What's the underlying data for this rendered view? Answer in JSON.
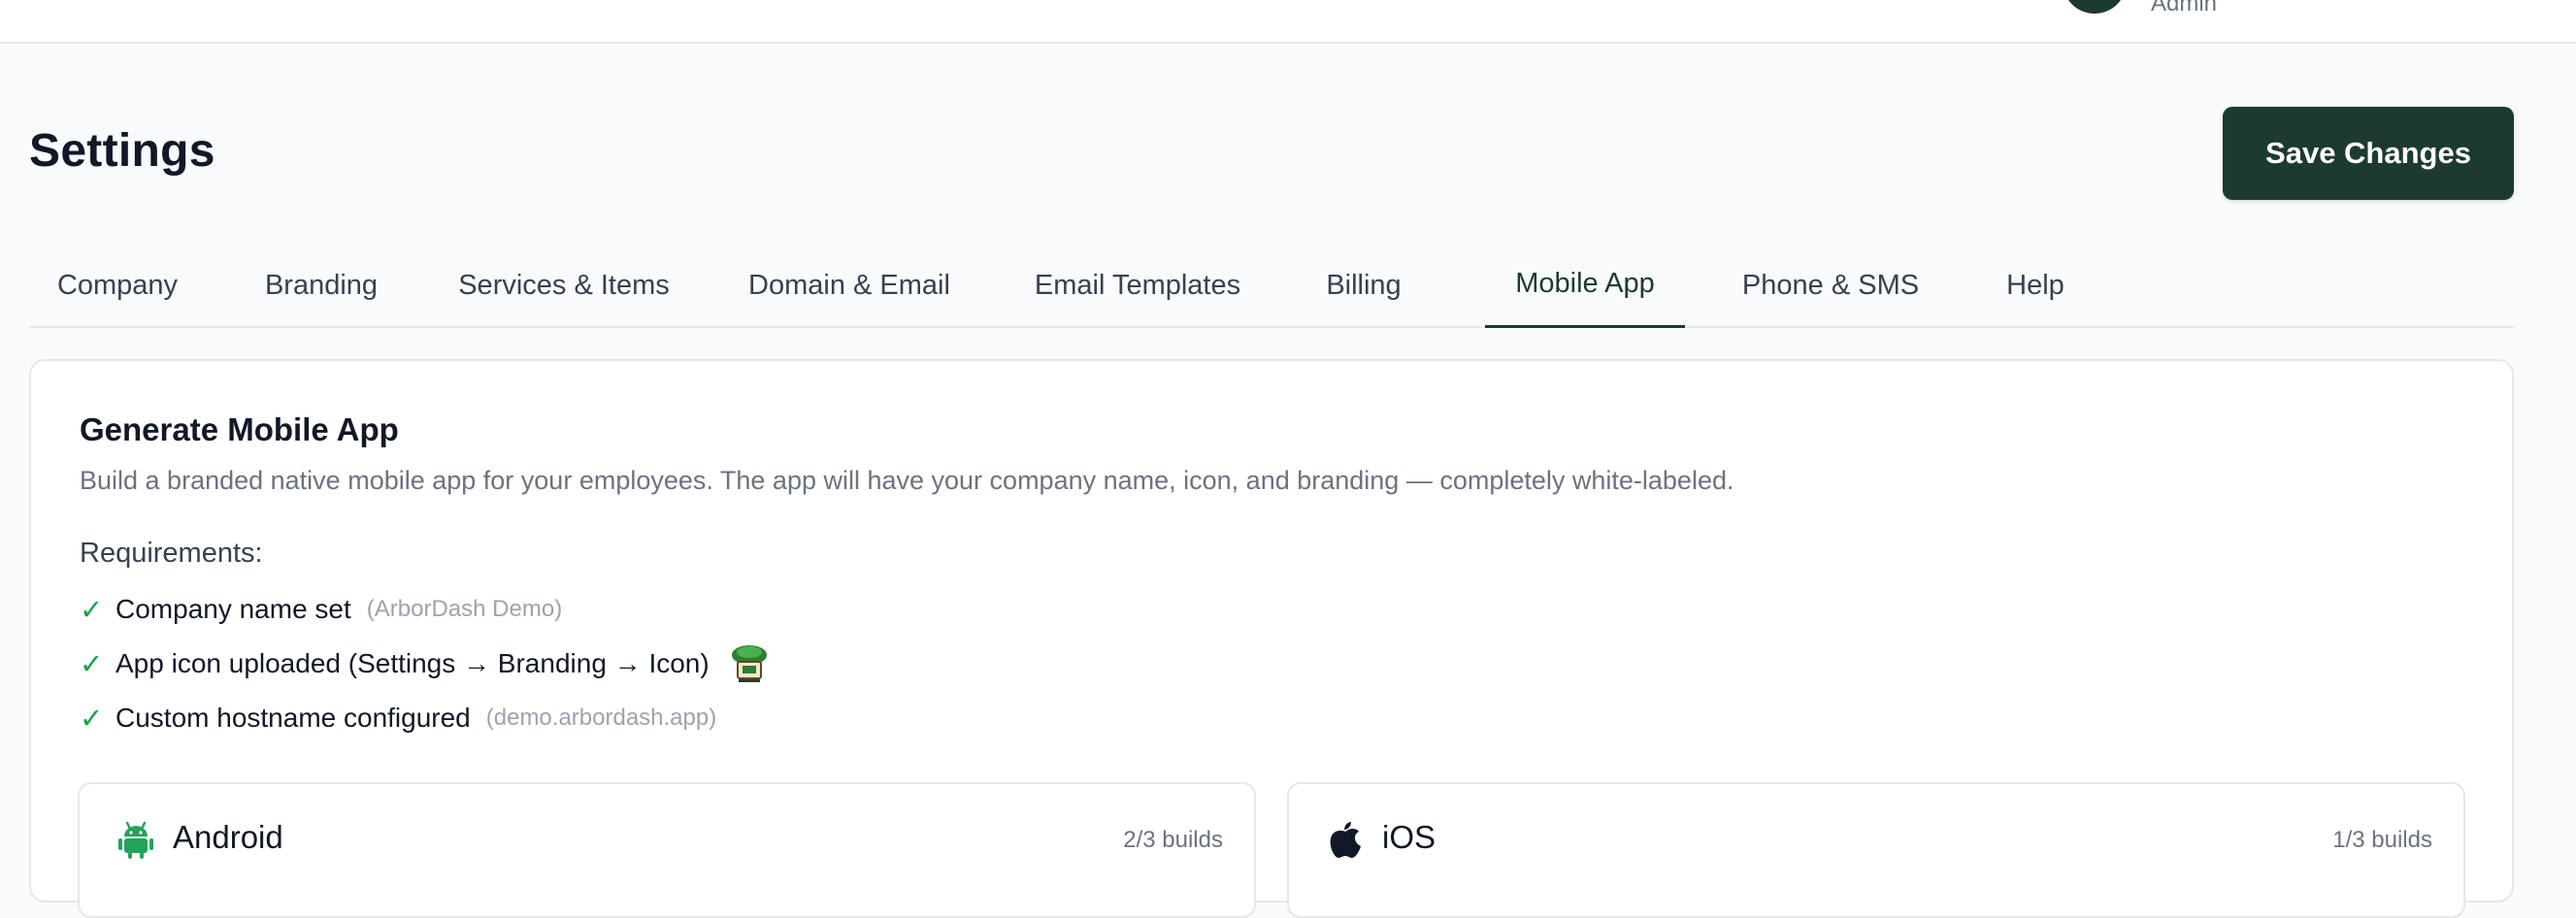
{
  "header": {
    "user_role": "Admin"
  },
  "page": {
    "title": "Settings",
    "save_label": "Save Changes"
  },
  "tabs": [
    {
      "label": "Company",
      "active": false
    },
    {
      "label": "Branding",
      "active": false
    },
    {
      "label": "Services & Items",
      "active": false
    },
    {
      "label": "Domain & Email",
      "active": false
    },
    {
      "label": "Email Templates",
      "active": false
    },
    {
      "label": "Billing",
      "active": false
    },
    {
      "label": "Mobile App",
      "active": true
    },
    {
      "label": "Phone & SMS",
      "active": false
    },
    {
      "label": "Help",
      "active": false
    }
  ],
  "mobile_app": {
    "title": "Generate Mobile App",
    "description": "Build a branded native mobile app for your employees. The app will have your company name, icon, and branding — completely white-labeled.",
    "requirements_heading": "Requirements:",
    "requirements": [
      {
        "icon": "check-icon",
        "label": "Company name set",
        "detail": "(ArborDash Demo)",
        "met": true
      },
      {
        "icon": "check-icon",
        "label": "App icon uploaded (Settings → Branding → Icon)",
        "detail": "",
        "met": true,
        "preview_icon": "tree-app-icon"
      },
      {
        "icon": "check-icon",
        "label": "Custom hostname configured",
        "detail": "(demo.arbordash.app)",
        "met": true
      }
    ],
    "platforms": [
      {
        "name": "Android",
        "icon": "android-icon",
        "builds": "2/3 builds"
      },
      {
        "name": "iOS",
        "icon": "apple-icon",
        "builds": "1/3 builds"
      }
    ]
  },
  "colors": {
    "brand": "#1c3b2e",
    "success": "#16a34a",
    "android": "#22a35a"
  }
}
